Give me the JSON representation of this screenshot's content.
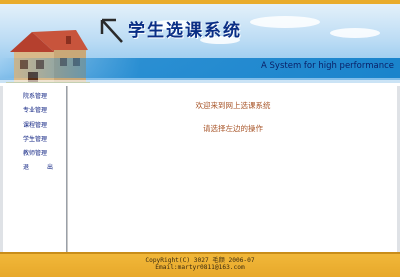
{
  "header": {
    "title": "学生选课系统",
    "tagline": "A System for high performance"
  },
  "sidebar": {
    "items": [
      {
        "label": "院系管理"
      },
      {
        "label": "专业管理"
      },
      {
        "label": "课程管理"
      },
      {
        "label": "学生管理"
      },
      {
        "label": "教师管理"
      },
      {
        "label": "退　出"
      }
    ]
  },
  "main": {
    "welcome": "欢迎来到网上选课系统",
    "instruction": "请选择左边的操作"
  },
  "footer": {
    "copyright": "CopyRight(C) 3027 毛颜 2006-07",
    "email": "Email:martyr0811@163.com"
  },
  "colors": {
    "accent": "#e9ac2c",
    "banner_blue": "#1a84cc",
    "title_blue": "#0a2e85",
    "menu_text": "#0b1f80",
    "content_text": "#a8562a"
  },
  "icons": {
    "house": "house-icon",
    "cursor": "cursor-arrow-icon"
  }
}
